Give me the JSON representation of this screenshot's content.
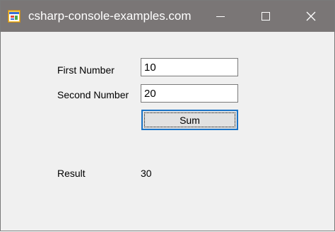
{
  "window": {
    "title": "csharp-console-examples.com",
    "icon": "windows-form-icon",
    "controls": [
      "minimize-icon",
      "maximize-icon",
      "close-icon"
    ]
  },
  "form": {
    "first_label": "First Number",
    "first_value": "10",
    "second_label": "Second Number",
    "second_value": "20",
    "sum_button": "Sum",
    "result_label": "Result",
    "result_value": "30"
  },
  "colors": {
    "titlebar": "#7a7676",
    "client_background": "#f0f0f0",
    "button_focus_border": "#1a73c6"
  }
}
